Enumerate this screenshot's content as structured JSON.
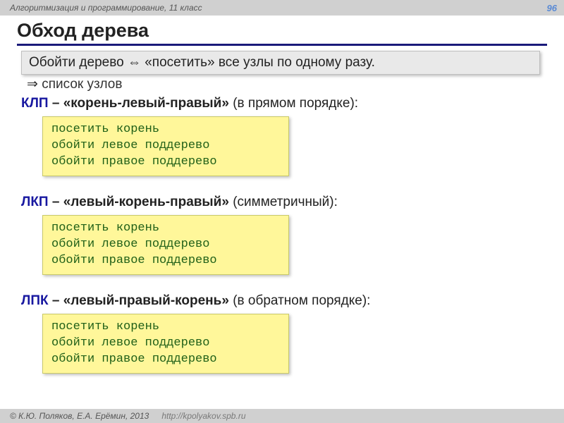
{
  "header": {
    "course": "Алгоритмизация и программирование, 11 класс",
    "page": "96"
  },
  "title": "Обход дерева",
  "definition": "Обойти дерево ⇔ «посетить» все узлы по одному разу.",
  "implies": "⇒ список узлов",
  "traversals": [
    {
      "abbr": "КЛП",
      "desc_bold": " – «корень-левый-правый»",
      "desc_rest": " (в прямом порядке):",
      "code": "посетить корень\nобойти левое поддерево\nобойти правое поддерево"
    },
    {
      "abbr": "ЛКП",
      "desc_bold": " – «левый-корень-правый»",
      "desc_rest": " (симметричный):",
      "code": "посетить корень\nобойти левое поддерево\nобойти правое поддерево"
    },
    {
      "abbr": "ЛПК",
      "desc_bold": " – «левый-правый-корень»",
      "desc_rest": " (в обратном порядке):",
      "code": "посетить корень\nобойти левое поддерево\nобойти правое поддерево"
    }
  ],
  "footer": {
    "authors": "© К.Ю. Поляков, Е.А. Ерёмин, 2013",
    "url": "http://kpolyakov.spb.ru"
  }
}
